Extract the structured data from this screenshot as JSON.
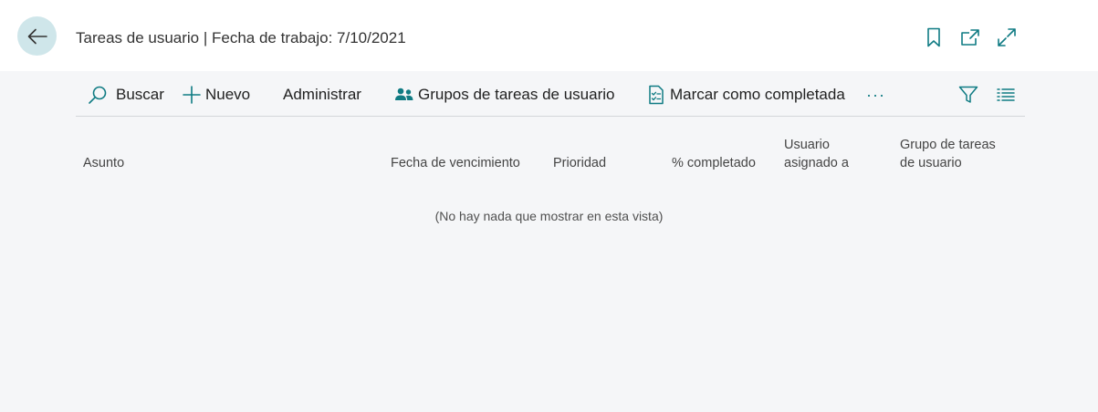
{
  "header": {
    "title": "Tareas de usuario | Fecha de trabajo: 7/10/2021",
    "icons": [
      "back-arrow-icon",
      "bookmark-icon",
      "open-new-window-icon",
      "expand-icon"
    ]
  },
  "toolbar": {
    "search_label": "Buscar",
    "new_label": "Nuevo",
    "manage_label": "Administrar",
    "task_groups_label": "Grupos de tareas de usuario",
    "mark_complete_label": "Marcar como completada",
    "more_label": "···"
  },
  "columns": {
    "subject": "Asunto",
    "due_date": "Fecha de vencimiento",
    "priority": "Prioridad",
    "percent_complete": "% completado",
    "assigned_user_1": "Usuario",
    "assigned_user_2": "asignado a",
    "task_group_1": "Grupo de tareas",
    "task_group_2": "de usuario"
  },
  "empty_message": "(No hay nada que mostrar en esta vista)",
  "colors": {
    "accent": "#0f7b83",
    "back_button_bg": "#cfe6ea",
    "page_bg": "#f5f6f8",
    "header_bg": "#ffffff"
  }
}
